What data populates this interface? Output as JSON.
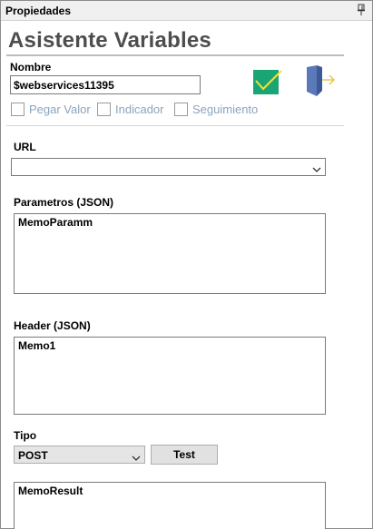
{
  "panel": {
    "title": "Propiedades",
    "pin_icon": "pin-icon"
  },
  "form": {
    "heading": "Asistente Variables",
    "nombre_label": "Nombre",
    "nombre_value": "$webservices11395",
    "confirm_icon": "checkmark-icon",
    "exit_icon": "exit-door-icon",
    "checkboxes": [
      {
        "label": "Pegar Valor",
        "checked": false
      },
      {
        "label": "Indicador",
        "checked": false
      },
      {
        "label": "Seguimiento",
        "checked": false
      }
    ],
    "url_label": "URL",
    "url_value": "",
    "params_label": "Parametros (JSON)",
    "params_value": "MemoParamm",
    "header_label": "Header (JSON)",
    "header_value": "Memo1",
    "tipo_label": "Tipo",
    "tipo_value": "POST",
    "test_label": "Test",
    "result_value": "MemoResult"
  },
  "colors": {
    "heading": "#4d4d4d",
    "checkbox_label": "#8aa4bc",
    "confirm_green": "#1aa575",
    "door_blue": "#5b78b8"
  }
}
